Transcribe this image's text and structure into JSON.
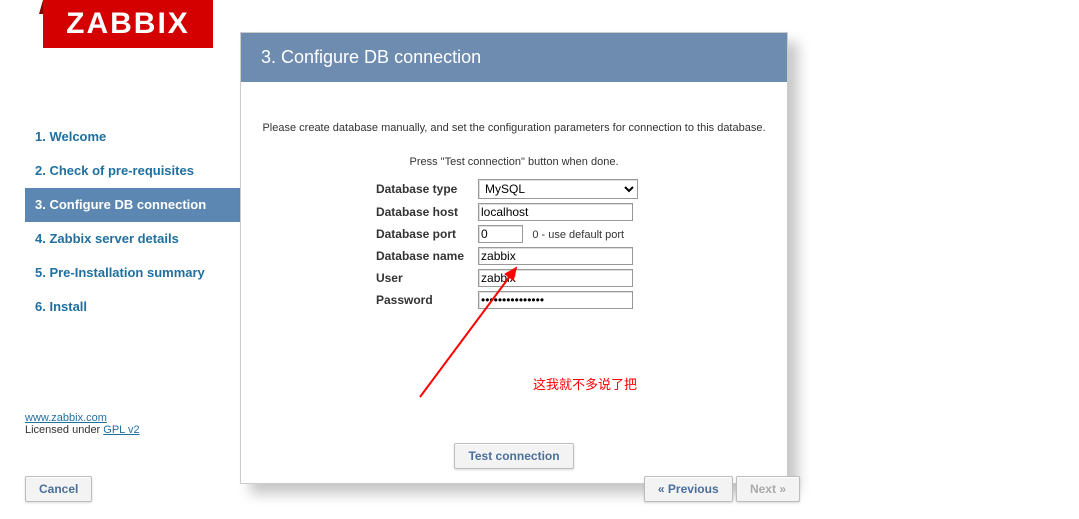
{
  "logo": {
    "text": "ZABBIX"
  },
  "steps": [
    {
      "label": "1. Welcome"
    },
    {
      "label": "2. Check of pre-requisites"
    },
    {
      "label": "3. Configure DB connection"
    },
    {
      "label": "4. Zabbix server details"
    },
    {
      "label": "5. Pre-Installation summary"
    },
    {
      "label": "6. Install"
    }
  ],
  "footer": {
    "site_link": "www.zabbix.com",
    "license_prefix": "Licensed under ",
    "license_link": "GPL v2"
  },
  "panel": {
    "title": "3. Configure DB connection",
    "intro": "Please create database manually, and set the configuration parameters for connection to this database.",
    "hint": "Press \"Test connection\" button when done.",
    "form": {
      "db_type_label": "Database type",
      "db_type_value": "MySQL",
      "db_host_label": "Database host",
      "db_host_value": "localhost",
      "db_port_label": "Database port",
      "db_port_value": "0",
      "db_port_note": "0 - use default port",
      "db_name_label": "Database name",
      "db_name_value": "zabbix",
      "user_label": "User",
      "user_value": "zabbix",
      "password_label": "Password",
      "password_value": "•••••••••••••••"
    },
    "annotation": "这我就不多说了把",
    "test_button": "Test connection"
  },
  "nav": {
    "cancel": "Cancel",
    "previous": "« Previous",
    "next": "Next »"
  }
}
